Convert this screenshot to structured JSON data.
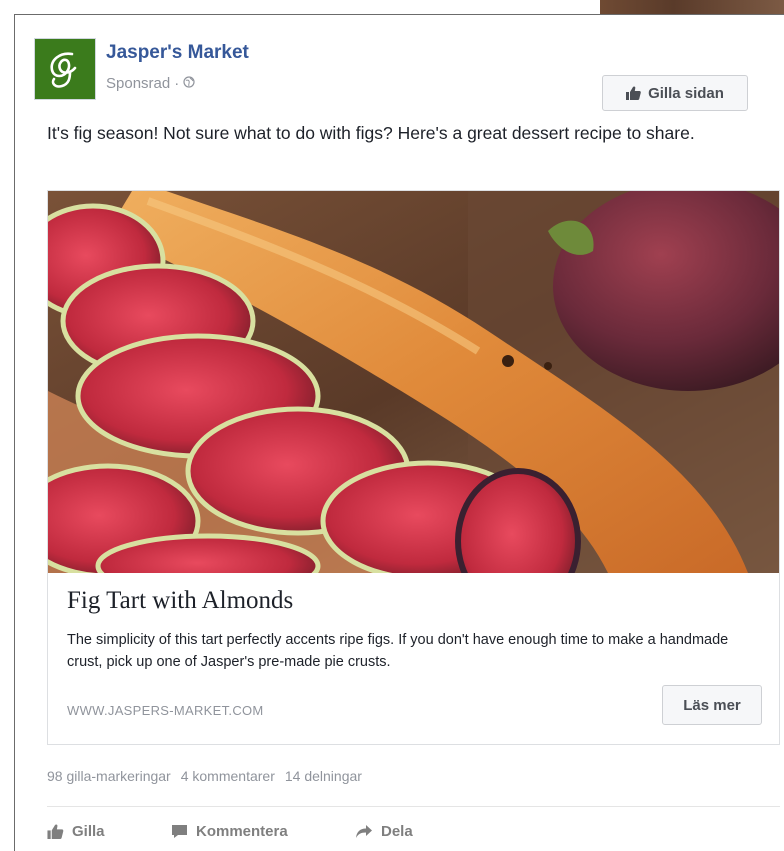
{
  "post": {
    "page_name": "Jasper's Market",
    "sponsored_label": "Sponsrad",
    "separator": "·",
    "like_page_label": "Gilla sidan",
    "message": "It's fig season! Not sure what to do with figs? Here's a great dessert recipe to share."
  },
  "link": {
    "title": "Fig Tart with Almonds",
    "description": "The simplicity of this tart perfectly accents ripe figs. If you don't have enough time to make a handmade crust, pick up one of Jasper's pre-made pie crusts.",
    "domain": "WWW.JASPERS-MARKET.COM",
    "cta_label": "Läs mer"
  },
  "stats": {
    "likes": "98 gilla-markeringar",
    "comments": "4 kommentarer",
    "shares": "14 delningar"
  },
  "actions": {
    "like": "Gilla",
    "comment": "Kommentera",
    "share": "Dela"
  },
  "colors": {
    "brand_green": "#3b7b1c",
    "link_blue": "#365899",
    "muted_text": "#90949c"
  },
  "icons": {
    "avatar": "jaspers-market-logo",
    "audience": "globe-icon",
    "like": "thumbs-up-icon",
    "comment": "speech-bubble-icon",
    "share": "share-arrow-icon"
  }
}
